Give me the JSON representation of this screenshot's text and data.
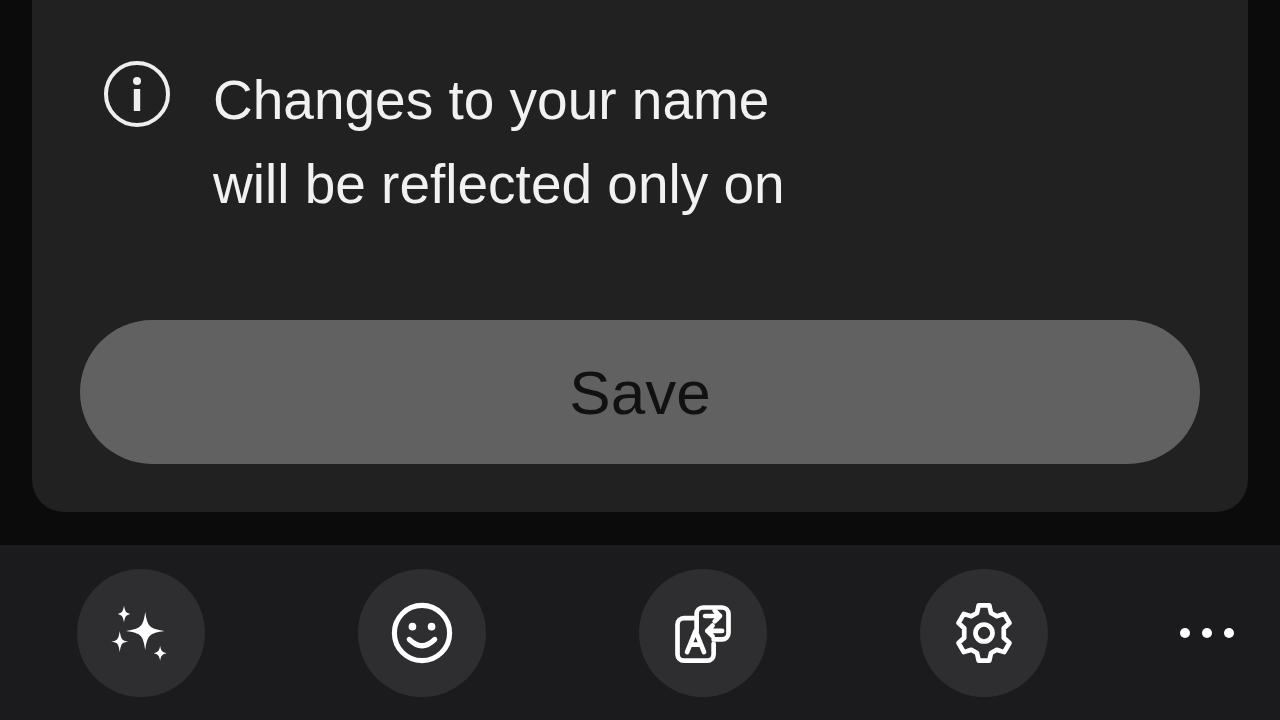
{
  "sheet": {
    "message_lines": [
      "Changes to your name",
      "will be reflected only on"
    ],
    "save_button": {
      "label": "Save",
      "disabled": true
    }
  },
  "keyboard_toolbar": [
    {
      "kind": "sparkle"
    },
    {
      "kind": "emoji"
    },
    {
      "kind": "translate"
    },
    {
      "kind": "settings"
    },
    {
      "kind": "more"
    }
  ]
}
